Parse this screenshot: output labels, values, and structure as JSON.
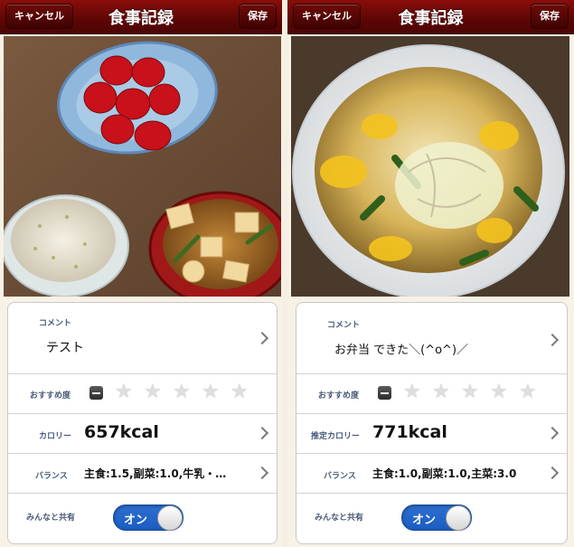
{
  "screens": [
    {
      "nav": {
        "title": "食事記録",
        "cancel": "キャンセル",
        "save": "保存"
      },
      "photo": {
        "subject": "strawberries-rice-miso-soup"
      },
      "comment": {
        "label": "コメント",
        "value": "テスト"
      },
      "rating": {
        "label": "おすすめ度",
        "stars": 0,
        "max": 5
      },
      "calorie": {
        "label": "カロリー",
        "value": "657kcal"
      },
      "balance": {
        "label": "バランス",
        "value": "主食:1.5,副菜:1.0,牛乳・…"
      },
      "share": {
        "label": "みんなと共有",
        "toggle": "オン",
        "on": true
      }
    },
    {
      "nav": {
        "title": "食事記録",
        "cancel": "キャンセル",
        "save": "保存"
      },
      "photo": {
        "subject": "egg-cabbage-rice-bowl"
      },
      "comment": {
        "label": "コメント",
        "value": "お弁当 できた＼(^o^)／"
      },
      "rating": {
        "label": "おすすめ度",
        "stars": 0,
        "max": 5
      },
      "calorie": {
        "label": "推定カロリー",
        "value": "771kcal"
      },
      "balance": {
        "label": "バランス",
        "value": "主食:1.0,副菜:1.0,主菜:3.0"
      },
      "share": {
        "label": "みんなと共有",
        "toggle": "オン",
        "on": true
      }
    }
  ],
  "colors": {
    "navbar": "#5f0705",
    "toggle_on": "#1b5dc1",
    "label": "#4a5a78",
    "background": "#f8f1e6"
  }
}
